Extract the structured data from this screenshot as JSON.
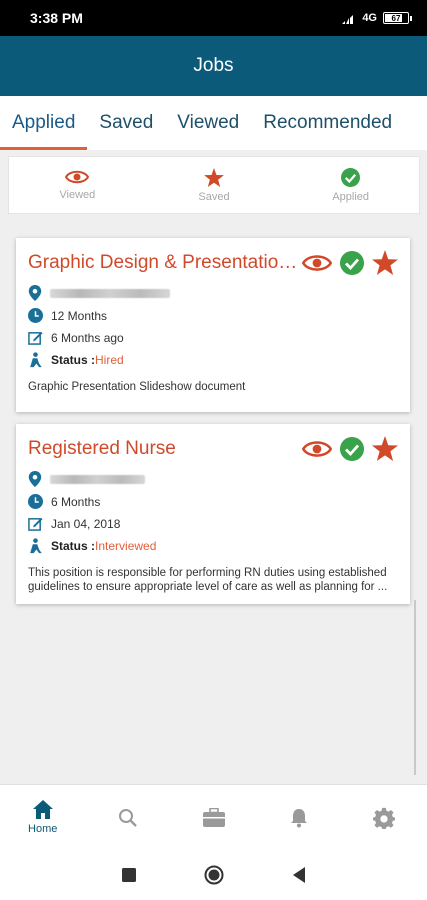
{
  "status_bar": {
    "time": "3:38 PM",
    "network": "4G",
    "battery": "67"
  },
  "header": {
    "title": "Jobs"
  },
  "tabs": [
    {
      "label": "Applied"
    },
    {
      "label": "Saved"
    },
    {
      "label": "Viewed"
    },
    {
      "label": "Recommended"
    }
  ],
  "legend": {
    "viewed": "Viewed",
    "saved": "Saved",
    "applied": "Applied"
  },
  "colors": {
    "primary": "#0c5a7a",
    "accent": "#d04a2a",
    "check": "#3aa24a"
  },
  "jobs": [
    {
      "title": "Graphic Design & Presentation ...",
      "duration": "12 Months",
      "posted": "6 Months ago",
      "status_label": "Status :",
      "status": "Hired",
      "description": "Graphic Presentation Slideshow document"
    },
    {
      "title": "Registered Nurse",
      "duration": "6 Months",
      "posted": "Jan 04, 2018",
      "status_label": "Status :",
      "status": "Interviewed",
      "description": "This position is responsible for performing RN duties using established guidelines to ensure appropriate level of care as well as planning for ..."
    }
  ],
  "bottom_nav": {
    "home": "Home"
  }
}
